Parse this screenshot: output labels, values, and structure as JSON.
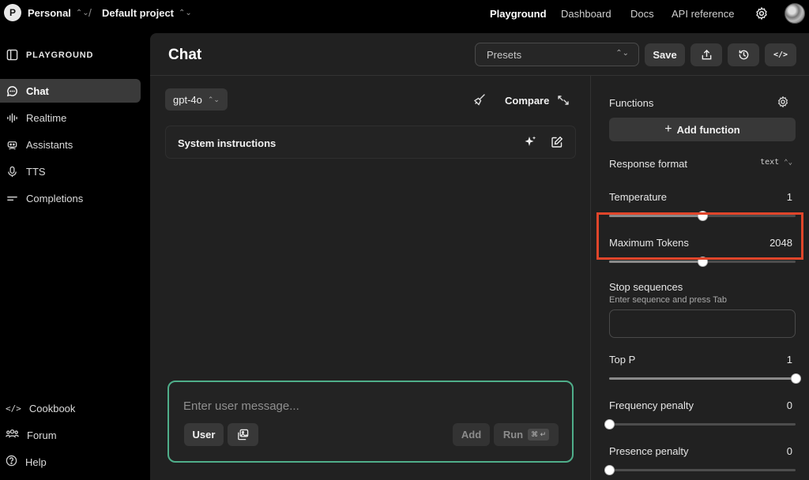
{
  "org": {
    "initial": "P",
    "name": "Personal"
  },
  "breadcrumb": {
    "separator": "/",
    "project": "Default project"
  },
  "topnav": [
    "Playground",
    "Dashboard",
    "Docs",
    "API reference"
  ],
  "sidebar": {
    "header": "PLAYGROUND",
    "items": [
      {
        "label": "Chat",
        "icon": "chat-bubble-icon",
        "active": true
      },
      {
        "label": "Realtime",
        "icon": "waveform-icon"
      },
      {
        "label": "Assistants",
        "icon": "robot-icon"
      },
      {
        "label": "TTS",
        "icon": "microphone-icon"
      },
      {
        "label": "Completions",
        "icon": "lines-icon"
      }
    ],
    "footer": [
      {
        "label": "Cookbook",
        "icon": "code-icon"
      },
      {
        "label": "Forum",
        "icon": "people-icon"
      },
      {
        "label": "Help",
        "icon": "question-icon"
      }
    ]
  },
  "header": {
    "title": "Chat",
    "presets_placeholder": "Presets",
    "save_label": "Save"
  },
  "chat": {
    "model": "gpt-4o",
    "compare_label": "Compare",
    "system_label": "System instructions",
    "message_placeholder": "Enter user message...",
    "role_label": "User",
    "add_label": "Add",
    "run_label": "Run",
    "run_shortcut": "⌘ ↵"
  },
  "settings": {
    "functions_label": "Functions",
    "add_function_label": "Add function",
    "response_format_label": "Response format",
    "response_format_value": "text",
    "temperature": {
      "label": "Temperature",
      "value": "1",
      "fraction": 0.5
    },
    "max_tokens": {
      "label": "Maximum Tokens",
      "value": "2048",
      "fraction": 0.5
    },
    "stop": {
      "label": "Stop sequences",
      "hint": "Enter sequence and press Tab"
    },
    "top_p": {
      "label": "Top P",
      "value": "1",
      "fraction": 1.0
    },
    "frequency": {
      "label": "Frequency penalty",
      "value": "0",
      "fraction": 0.0
    },
    "presence": {
      "label": "Presence penalty",
      "value": "0",
      "fraction": 0.0
    }
  },
  "colors": {
    "accent_green": "#4fae8a",
    "highlight_red": "#e0452a"
  }
}
